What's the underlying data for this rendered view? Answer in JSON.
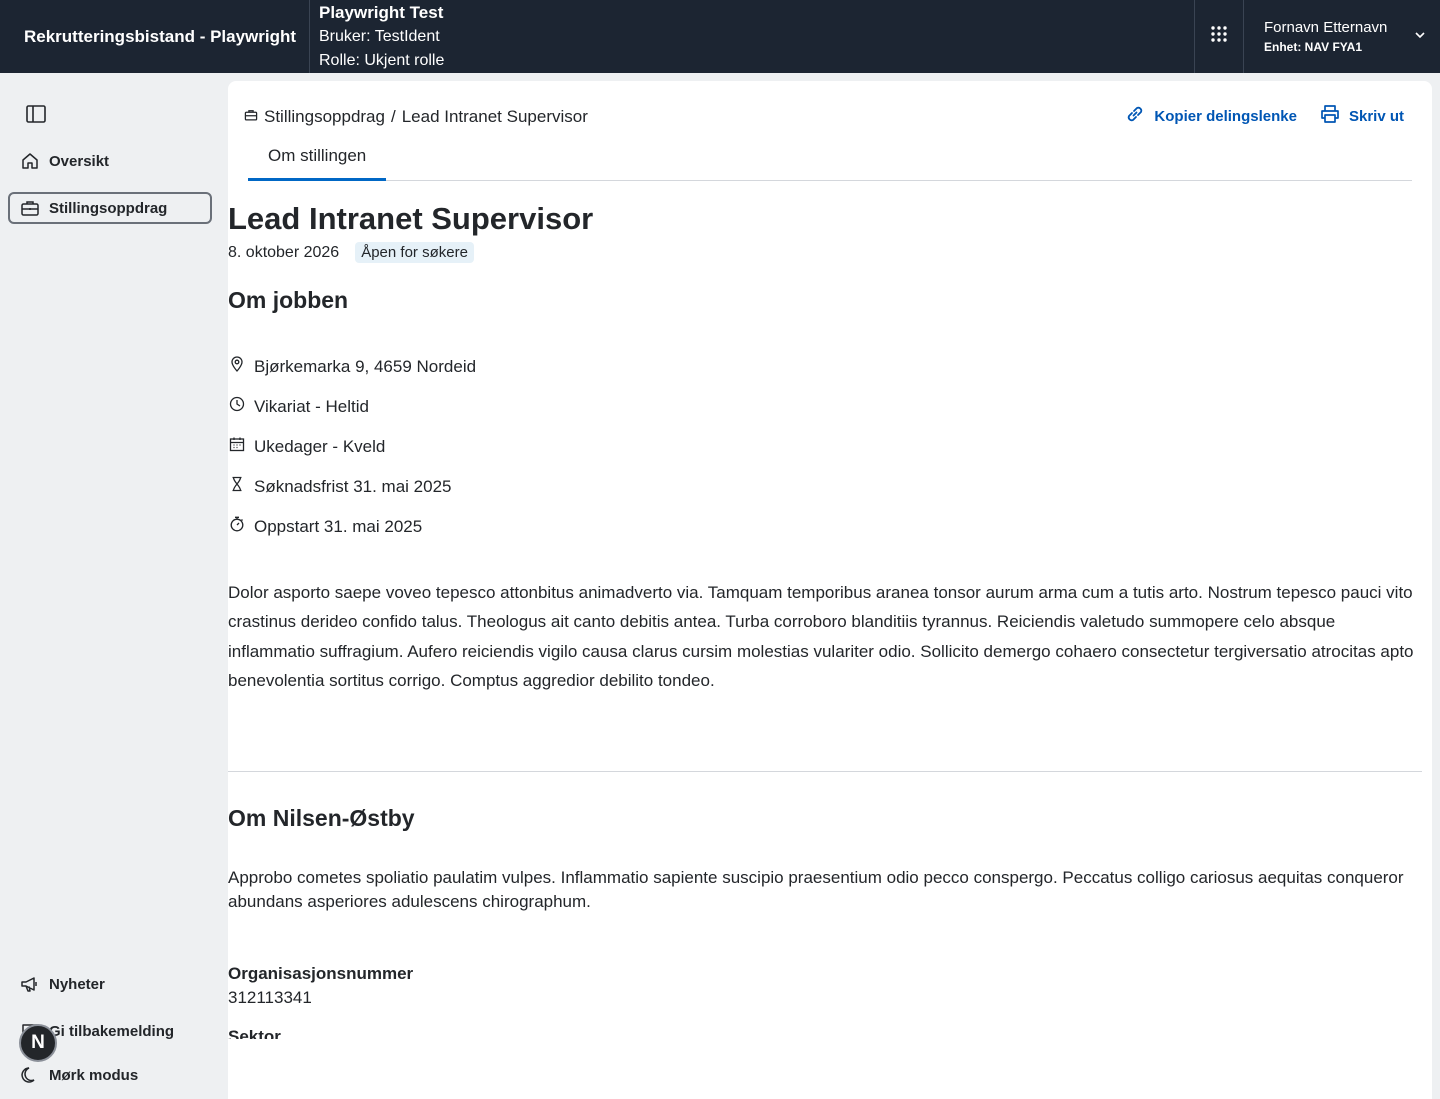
{
  "header": {
    "app_title": "Rekrutteringsbistand - Playwright",
    "env_title": "Playwright Test",
    "env_user": "Bruker: TestIdent",
    "env_role": "Rolle: Ukjent rolle",
    "user_name": "Fornavn Etternavn",
    "user_unit": "Enhet: NAV FYA1"
  },
  "sidebar": {
    "items": [
      {
        "label": "Oversikt",
        "icon": "house-icon"
      },
      {
        "label": "Stillingsoppdrag",
        "icon": "briefcase-icon",
        "active": true
      }
    ],
    "bottom": [
      {
        "label": "Nyheter",
        "icon": "megaphone-icon"
      },
      {
        "label": "Gi tilbakemelding",
        "icon": "feedback-icon"
      },
      {
        "label": "Mørk modus",
        "icon": "moon-icon"
      }
    ],
    "fab_letter": "N"
  },
  "breadcrumb": {
    "parent": "Stillingsoppdrag",
    "separator": "/",
    "current": "Lead Intranet Supervisor"
  },
  "actions": {
    "copy_link": "Kopier delingslenke",
    "print": "Skriv ut"
  },
  "tabs": [
    {
      "label": "Om stillingen",
      "active": true
    }
  ],
  "job": {
    "title": "Lead Intranet Supervisor",
    "date": "8. oktober 2026",
    "status_tag": "Åpen for søkere",
    "section_title": "Om jobben",
    "facts": [
      {
        "icon": "location-pin-icon",
        "text": "Bjørkemarka 9, 4659 Nordeid"
      },
      {
        "icon": "clock-icon",
        "text": "Vikariat - Heltid"
      },
      {
        "icon": "calendar-icon",
        "text": "Ukedager - Kveld"
      },
      {
        "icon": "hourglass-icon",
        "text": "Søknadsfrist 31. mai 2025"
      },
      {
        "icon": "stopwatch-icon",
        "text": "Oppstart 31. mai 2025"
      }
    ],
    "description": "Dolor asporto saepe voveo tepesco attonbitus animadverto via. Tamquam temporibus aranea tonsor aurum arma cum a tutis arto. Nostrum tepesco pauci vito crastinus derideo confido talus. Theologus ait canto debitis antea. Turba corroboro blanditiis tyrannus. Reiciendis valetudo summopere celo absque inflammatio suffragium. Aufero reiciendis vigilo causa clarus cursim molestias vulariter odio. Sollicito demergo cohaero consectetur tergiversatio atrocitas apto benevolentia sortitus corrigo. Comptus aggredior debilito tondeo."
  },
  "employer": {
    "title": "Om Nilsen-Østby",
    "description": "Approbo cometes spoliatio paulatim vulpes. Inflammatio sapiente suscipio praesentium odio pecco conspergo. Peccatus colligo cariosus aequitas conqueror abundans asperiores adulescens chirographum.",
    "org_label": "Organisasjonsnummer",
    "org_value": "312113341",
    "sector_label": "Sektor"
  },
  "colors": {
    "header_bg": "#1c2532",
    "link_blue": "#0056b4",
    "tab_underline": "#0067c5",
    "tag_bg": "#e6f1f8",
    "sidebar_bg": "#eef0f2"
  }
}
